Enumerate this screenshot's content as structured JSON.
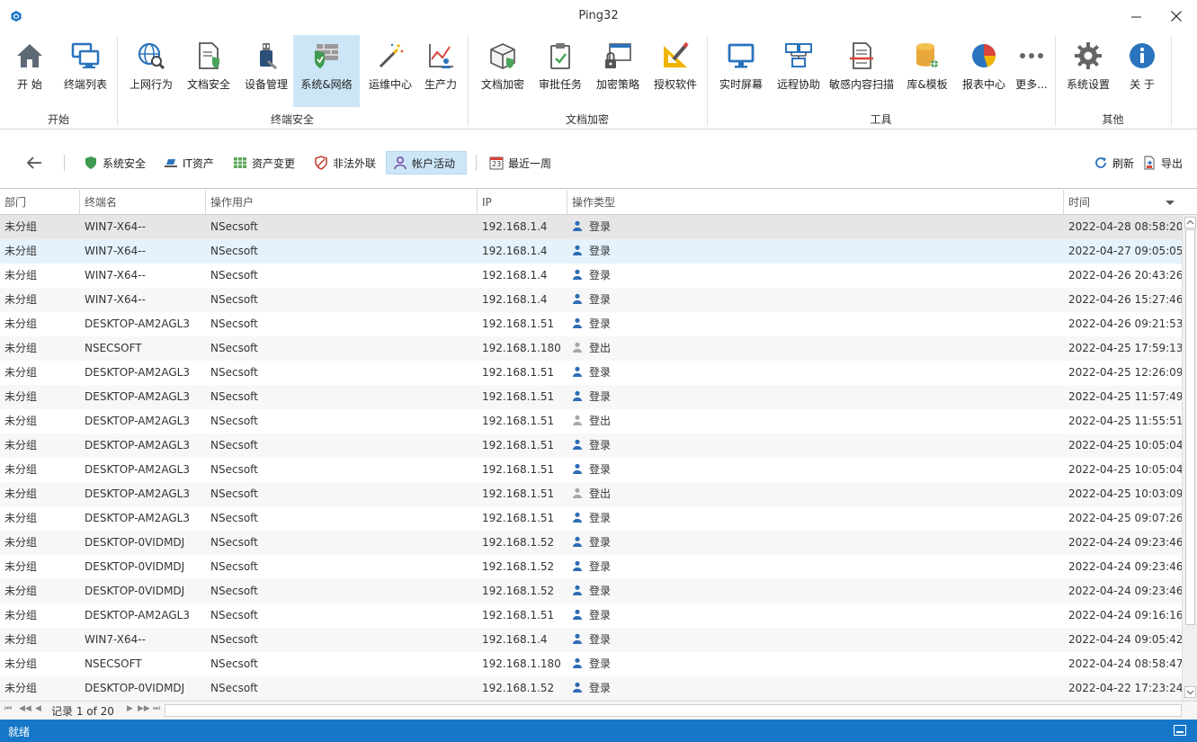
{
  "window": {
    "title": "Ping32"
  },
  "ribbon": {
    "buttons": [
      {
        "label": "开 始",
        "icon": "home-icon"
      },
      {
        "label": "终端列表",
        "icon": "computers-icon"
      },
      {
        "label": "上网行为",
        "icon": "globe-search-icon"
      },
      {
        "label": "文档安全",
        "icon": "document-shield-icon"
      },
      {
        "label": "设备管理",
        "icon": "usb-device-icon"
      },
      {
        "label": "系统&网络",
        "icon": "firewall-shield-icon"
      },
      {
        "label": "运维中心",
        "icon": "magic-wand-icon"
      },
      {
        "label": "生产力",
        "icon": "productivity-chart-icon"
      },
      {
        "label": "文档加密",
        "icon": "encrypted-box-icon"
      },
      {
        "label": "审批任务",
        "icon": "clipboard-check-icon"
      },
      {
        "label": "加密策略",
        "icon": "lock-window-icon"
      },
      {
        "label": "授权软件",
        "icon": "license-pencil-icon"
      },
      {
        "label": "实时屏幕",
        "icon": "monitor-icon"
      },
      {
        "label": "远程协助",
        "icon": "remote-network-icon"
      },
      {
        "label": "敏感内容扫描",
        "icon": "document-scan-icon"
      },
      {
        "label": "库&模板",
        "icon": "database-icon"
      },
      {
        "label": "报表中心",
        "icon": "pie-chart-icon"
      },
      {
        "label": "更多...",
        "icon": "more-dots-icon"
      },
      {
        "label": "系统设置",
        "icon": "gear-icon"
      },
      {
        "label": "关 于",
        "icon": "info-icon"
      }
    ],
    "groups": [
      "开始",
      "终端安全",
      "文档加密",
      "工具",
      "其他"
    ]
  },
  "toolbar": {
    "items": [
      {
        "label": "系统安全",
        "icon": "shield-icon"
      },
      {
        "label": "IT资产",
        "icon": "it-asset-icon"
      },
      {
        "label": "资产变更",
        "icon": "grid-change-icon"
      },
      {
        "label": "非法外联",
        "icon": "illegal-connection-icon"
      },
      {
        "label": "帐户活动",
        "icon": "account-activity-icon"
      },
      {
        "label": "最近一周",
        "icon": "calendar-icon",
        "calendar_day": "23"
      }
    ],
    "refresh": "刷新",
    "export": "导出"
  },
  "table": {
    "columns": [
      "部门",
      "终端名",
      "操作用户",
      "IP",
      "操作类型",
      "时间"
    ],
    "rows": [
      [
        "未分组",
        "WIN7-X64--",
        "NSecsoft",
        "192.168.1.4",
        "登录",
        "2022-04-28 08:58:20"
      ],
      [
        "未分组",
        "WIN7-X64--",
        "NSecsoft",
        "192.168.1.4",
        "登录",
        "2022-04-27 09:05:05"
      ],
      [
        "未分组",
        "WIN7-X64--",
        "NSecsoft",
        "192.168.1.4",
        "登录",
        "2022-04-26 20:43:26"
      ],
      [
        "未分组",
        "WIN7-X64--",
        "NSecsoft",
        "192.168.1.4",
        "登录",
        "2022-04-26 15:27:46"
      ],
      [
        "未分组",
        "DESKTOP-AM2AGL3",
        "NSecsoft",
        "192.168.1.51",
        "登录",
        "2022-04-26 09:21:53"
      ],
      [
        "未分组",
        "NSECSOFT",
        "NSecsoft",
        "192.168.1.180",
        "登出",
        "2022-04-25 17:59:13"
      ],
      [
        "未分组",
        "DESKTOP-AM2AGL3",
        "NSecsoft",
        "192.168.1.51",
        "登录",
        "2022-04-25 12:26:09"
      ],
      [
        "未分组",
        "DESKTOP-AM2AGL3",
        "NSecsoft",
        "192.168.1.51",
        "登录",
        "2022-04-25 11:57:49"
      ],
      [
        "未分组",
        "DESKTOP-AM2AGL3",
        "NSecsoft",
        "192.168.1.51",
        "登出",
        "2022-04-25 11:55:51"
      ],
      [
        "未分组",
        "DESKTOP-AM2AGL3",
        "NSecsoft",
        "192.168.1.51",
        "登录",
        "2022-04-25 10:05:04"
      ],
      [
        "未分组",
        "DESKTOP-AM2AGL3",
        "NSecsoft",
        "192.168.1.51",
        "登录",
        "2022-04-25 10:05:04"
      ],
      [
        "未分组",
        "DESKTOP-AM2AGL3",
        "NSecsoft",
        "192.168.1.51",
        "登出",
        "2022-04-25 10:03:09"
      ],
      [
        "未分组",
        "DESKTOP-AM2AGL3",
        "NSecsoft",
        "192.168.1.51",
        "登录",
        "2022-04-25 09:07:26"
      ],
      [
        "未分组",
        "DESKTOP-0VIDMDJ",
        "NSecsoft",
        "192.168.1.52",
        "登录",
        "2022-04-24 09:23:46"
      ],
      [
        "未分组",
        "DESKTOP-0VIDMDJ",
        "NSecsoft",
        "192.168.1.52",
        "登录",
        "2022-04-24 09:23:46"
      ],
      [
        "未分组",
        "DESKTOP-0VIDMDJ",
        "NSecsoft",
        "192.168.1.52",
        "登录",
        "2022-04-24 09:23:46"
      ],
      [
        "未分组",
        "DESKTOP-AM2AGL3",
        "NSecsoft",
        "192.168.1.51",
        "登录",
        "2022-04-24 09:16:16"
      ],
      [
        "未分组",
        "WIN7-X64--",
        "NSecsoft",
        "192.168.1.4",
        "登录",
        "2022-04-24 09:05:42"
      ],
      [
        "未分组",
        "NSECSOFT",
        "NSecsoft",
        "192.168.1.180",
        "登录",
        "2022-04-24 08:58:47"
      ],
      [
        "未分组",
        "DESKTOP-0VIDMDJ",
        "NSecsoft",
        "192.168.1.52",
        "登录",
        "2022-04-22 17:23:24"
      ]
    ]
  },
  "navigator": {
    "text": "记录 1 of 20"
  },
  "status": {
    "text": "就绪"
  },
  "colors": {
    "accent": "#1677c9",
    "selected": "#cde6f7",
    "login_icon": "#2f6db5",
    "logout_icon": "#a8a8a8"
  }
}
